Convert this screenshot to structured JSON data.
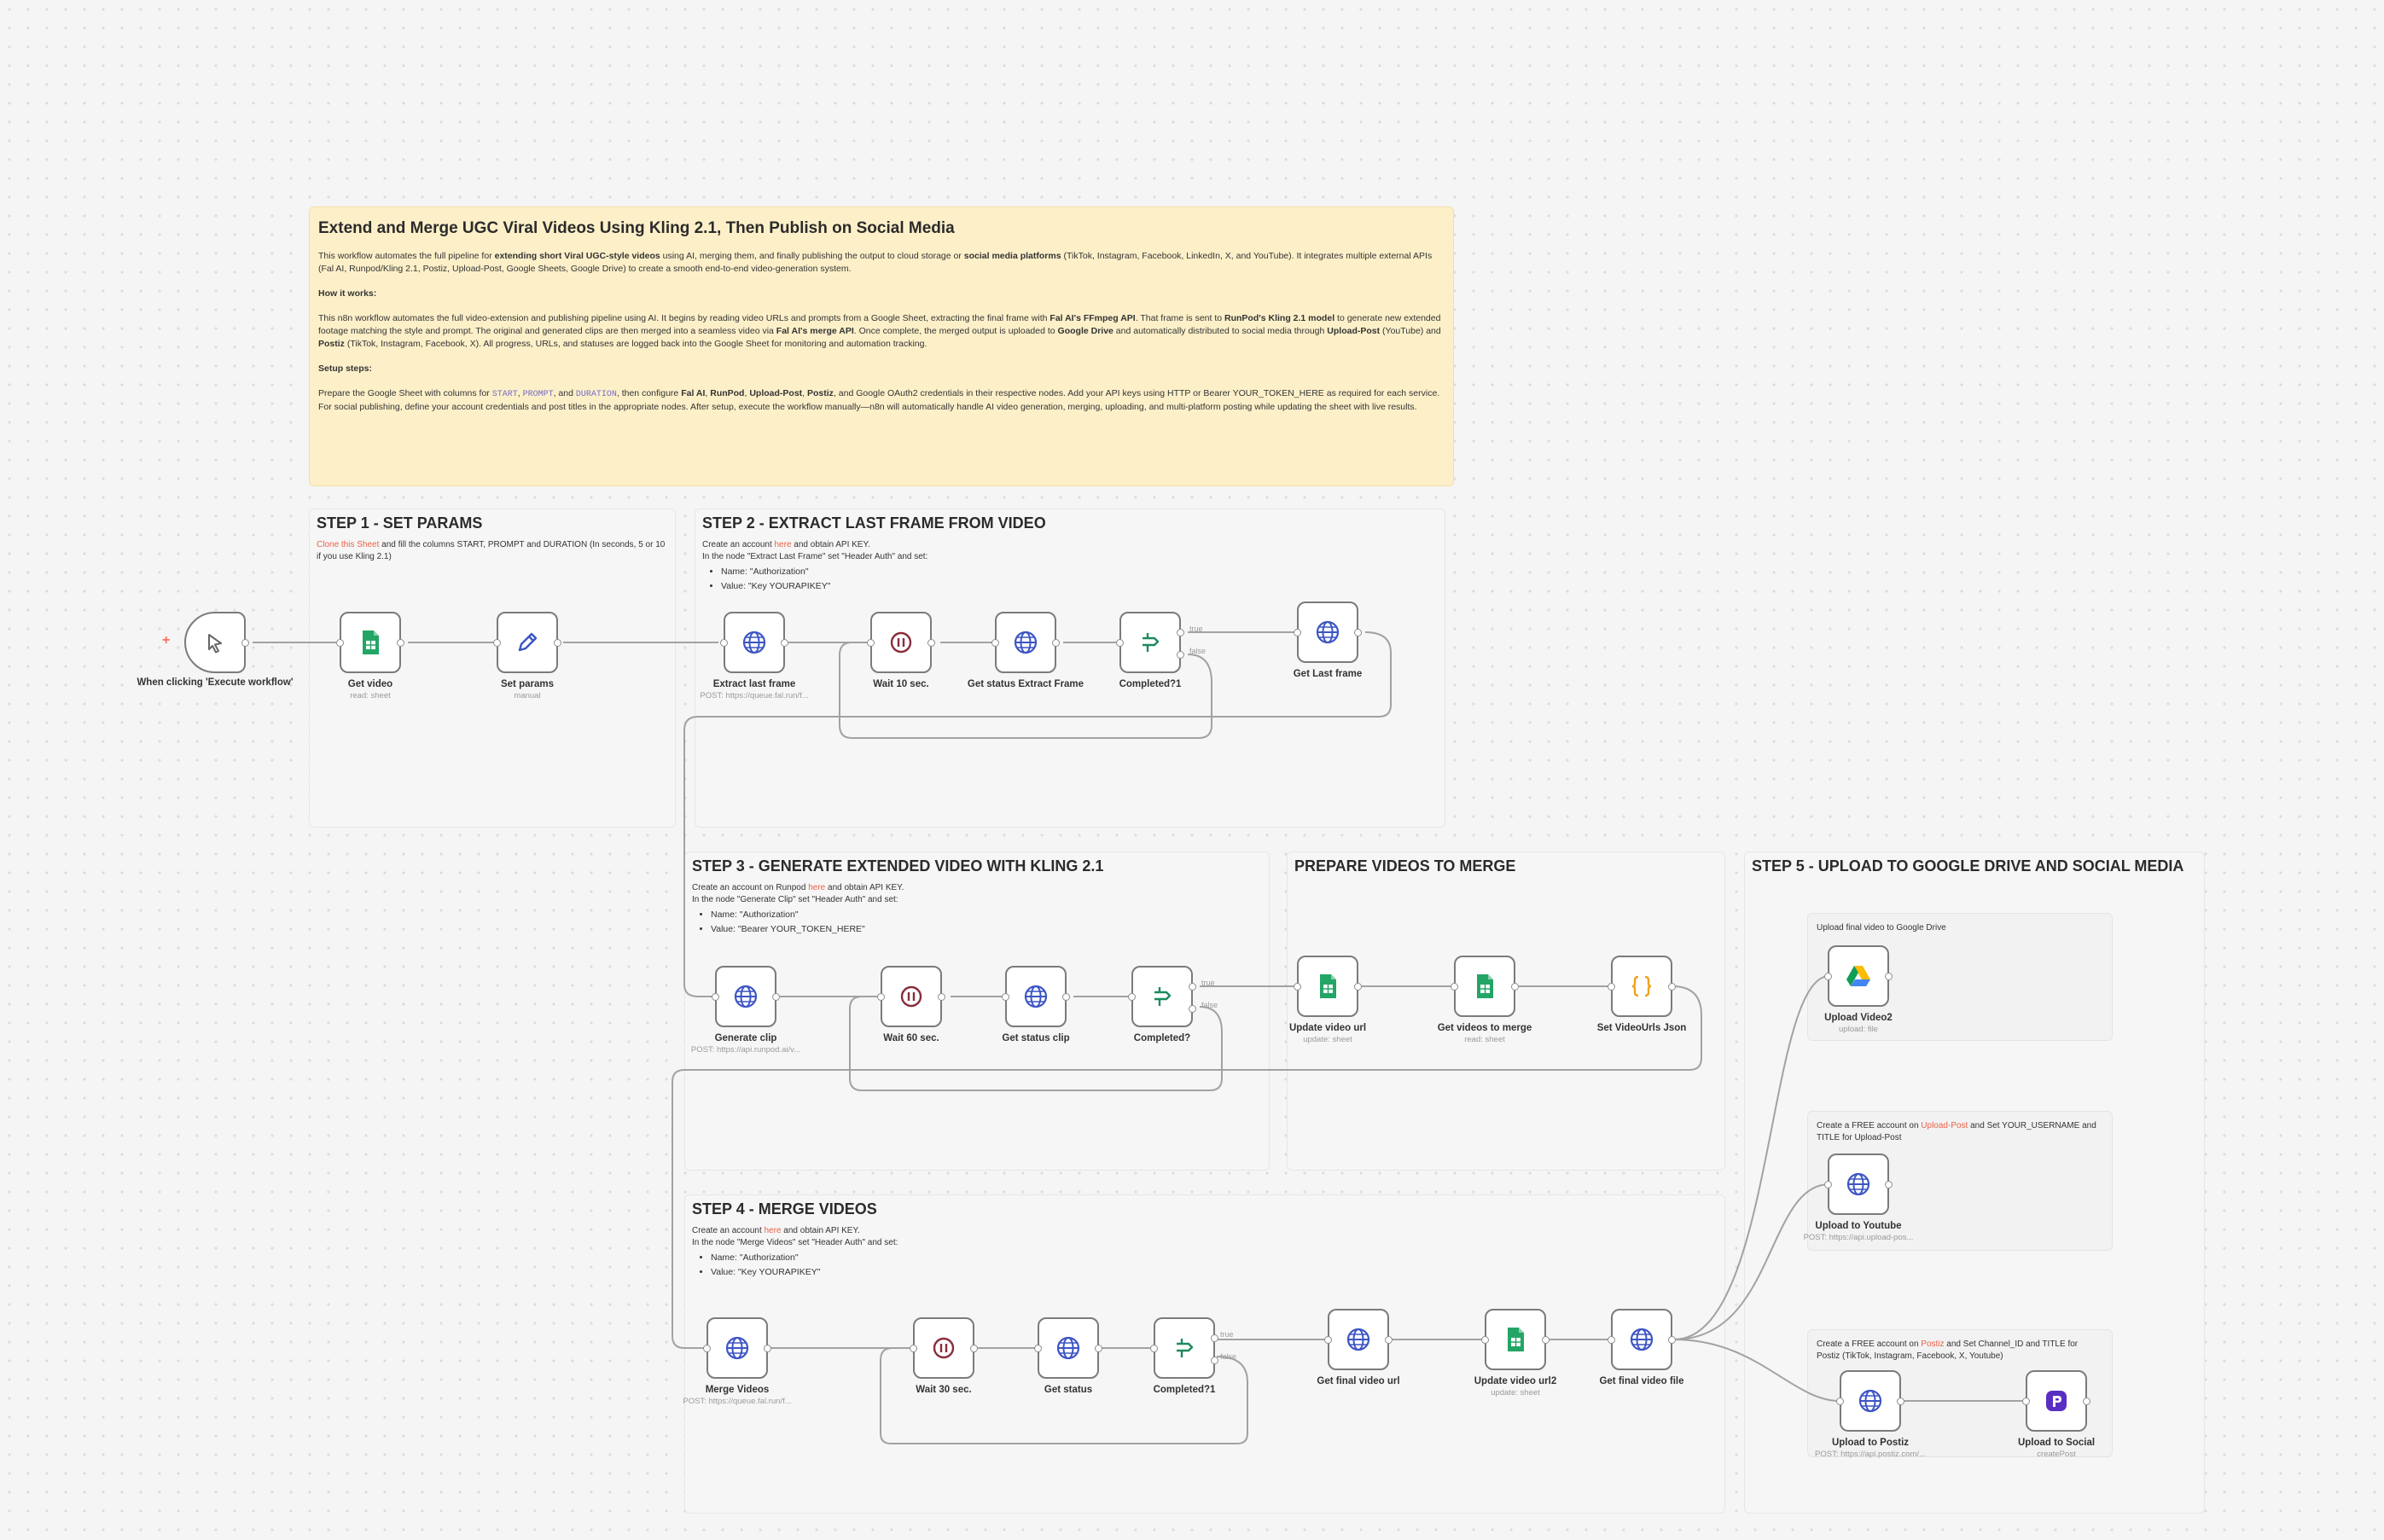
{
  "canvas": {
    "sticky_intro": {
      "title": "Extend and Merge UGC Viral Videos Using Kling 2.1, Then Publish on Social Media",
      "para1_a": "This workflow automates the full pipeline for ",
      "para1_b": "extending short Viral UGC-style videos",
      "para1_c": " using AI, merging them, and finally publishing the output to cloud storage or ",
      "para1_d": "social media platforms",
      "para1_e": " (TikTok, Instagram, Facebook, LinkedIn, X, and YouTube). It integrates multiple external APIs (Fal AI, Runpod/Kling 2.1, Postiz, Upload-Post, Google Sheets, Google Drive) to create a smooth end-to-end video-generation system.",
      "how_heading": "How it works:",
      "para2_a": "This n8n workflow automates the full video-extension and publishing pipeline using AI. It begins by reading video URLs and prompts from a Google Sheet, extracting the final frame with ",
      "para2_b": "Fal AI's FFmpeg API",
      "para2_c": ". That frame is sent to ",
      "para2_d": "RunPod's Kling 2.1 model",
      "para2_e": " to generate new extended footage matching the style and prompt. The original and generated clips are then merged into a seamless video via ",
      "para2_f": "Fal AI's merge API",
      "para2_g": ". Once complete, the merged output is uploaded to ",
      "para2_h": "Google Drive",
      "para2_i": " and automatically distributed to social media through ",
      "para2_j": "Upload-Post",
      "para2_k": " (YouTube) and ",
      "para2_l": "Postiz",
      "para2_m": " (TikTok, Instagram, Facebook, X). All progress, URLs, and statuses are logged back into the Google Sheet for monitoring and automation tracking.",
      "setup_heading": "Setup steps:",
      "para3_a": "Prepare the Google Sheet with columns for ",
      "para3_b": "START",
      "para3_c": ", ",
      "para3_d": "PROMPT",
      "para3_e": ", and ",
      "para3_f": "DURATION",
      "para3_g": ", then configure ",
      "para3_h": "Fal AI",
      "para3_i": ", ",
      "para3_j": "RunPod",
      "para3_k": ", ",
      "para3_l": "Upload-Post",
      "para3_m": ", ",
      "para3_n": "Postiz",
      "para3_o": ", and Google OAuth2 credentials in their respective nodes. Add your API keys using HTTP or Bearer YOUR_TOKEN_HERE as required for each service. For social publishing, define your account credentials and post titles in the appropriate nodes. After setup, execute the workflow manually—n8n will automatically handle AI video generation, merging, uploading, and multi-platform posting while updating the sheet with live results."
    },
    "step1": {
      "title": "STEP 1 - SET PARAMS",
      "link": "Clone this Sheet",
      "text": " and fill the columns START, PROMPT and DURATION (In seconds, 5 or 10 if you use Kling 2.1)"
    },
    "step2": {
      "title": "STEP 2 - EXTRACT LAST FRAME FROM VIDEO",
      "text_a": "Create an account ",
      "link": "here",
      "text_b": " and obtain API KEY.",
      "text_c": "In the node \"Extract Last Frame\" set \"Header Auth\" and set:",
      "bullets": [
        "Name: \"Authorization\"",
        "Value: \"Key YOURAPIKEY\""
      ]
    },
    "step3": {
      "title": "STEP 3 - GENERATE EXTENDED VIDEO WITH KLING 2.1",
      "text_a": "Create an account on Runpod ",
      "link": "here",
      "text_b": " and obtain API KEY.",
      "text_c": "In the node \"Generate Clip\" set \"Header Auth\" and set:",
      "bullets": [
        "Name: \"Authorization\"",
        "Value: \"Bearer YOUR_TOKEN_HERE\""
      ]
    },
    "prepare": {
      "title": "PREPARE VIDEOS TO MERGE"
    },
    "step4": {
      "title": "STEP 4 - MERGE VIDEOS",
      "text_a": "Create an account ",
      "link": "here",
      "text_b": " and obtain API KEY.",
      "text_c": "In the node \"Merge Videos\" set \"Header Auth\" and set:",
      "bullets": [
        "Name: \"Authorization\"",
        "Value: \"Key YOURAPIKEY\""
      ]
    },
    "step5": {
      "title": "STEP 5 - UPLOAD TO GOOGLE DRIVE AND SOCIAL MEDIA",
      "drive_note": "Upload final video to Google Drive",
      "uploadpost_a": "Create a FREE account on ",
      "uploadpost_link": "Upload-Post",
      "uploadpost_b": " and Set YOUR_USERNAME and TITLE for Upload-Post",
      "postiz_a": "Create a FREE account on ",
      "postiz_link": "Postiz",
      "postiz_b": " and Set Channel_ID and TITLE for Postiz (TikTok, Instagram, Facebook, X, Youtube)"
    }
  },
  "nodes": {
    "trigger": {
      "label": "When clicking 'Execute workflow'",
      "icon": "cursor-icon"
    },
    "get_video": {
      "label": "Get video",
      "sub": "read: sheet",
      "icon": "google-sheets-icon"
    },
    "set_params": {
      "label": "Set params",
      "sub": "manual",
      "icon": "pencil-icon"
    },
    "extract_last_frame": {
      "label": "Extract last frame",
      "sub": "POST: https://queue.fal.run/f...",
      "icon": "globe-icon"
    },
    "wait_10": {
      "label": "Wait 10 sec.",
      "icon": "pause-icon"
    },
    "get_status_extract": {
      "label": "Get status Extract Frame",
      "icon": "globe-icon"
    },
    "completed1": {
      "label": "Completed?1",
      "true": "true",
      "false": "false",
      "icon": "if-icon"
    },
    "get_last_frame": {
      "label": "Get Last frame",
      "icon": "globe-icon"
    },
    "generate_clip": {
      "label": "Generate clip",
      "sub": "POST: https://api.runpod.ai/v...",
      "icon": "globe-icon"
    },
    "wait_60": {
      "label": "Wait 60 sec.",
      "icon": "pause-icon"
    },
    "get_status_clip": {
      "label": "Get status clip",
      "icon": "globe-icon"
    },
    "completed": {
      "label": "Completed?",
      "true": "true",
      "false": "false",
      "icon": "if-icon"
    },
    "update_video_url": {
      "label": "Update video url",
      "sub": "update: sheet",
      "icon": "google-sheets-icon"
    },
    "get_videos_merge": {
      "label": "Get videos to merge",
      "sub": "read: sheet",
      "icon": "google-sheets-icon"
    },
    "set_videourls_json": {
      "label": "Set VideoUrls Json",
      "icon": "code-braces-icon"
    },
    "merge_videos": {
      "label": "Merge Videos",
      "sub": "POST: https://queue.fal.run/f...",
      "icon": "globe-icon"
    },
    "wait_30": {
      "label": "Wait 30 sec.",
      "icon": "pause-icon"
    },
    "get_status": {
      "label": "Get status",
      "icon": "globe-icon"
    },
    "completed2": {
      "label": "Completed?1",
      "true": "true",
      "false": "false",
      "icon": "if-icon"
    },
    "get_final_video_url": {
      "label": "Get final video url",
      "icon": "globe-icon"
    },
    "update_video_url2": {
      "label": "Update video url2",
      "sub": "update: sheet",
      "icon": "google-sheets-icon"
    },
    "get_final_video_file": {
      "label": "Get final video file",
      "icon": "globe-icon"
    },
    "upload_video2": {
      "label": "Upload Video2",
      "sub": "upload: file",
      "icon": "google-drive-icon"
    },
    "upload_youtube": {
      "label": "Upload to Youtube",
      "sub": "POST: https://api.upload-pos...",
      "icon": "globe-icon"
    },
    "upload_postiz": {
      "label": "Upload to Postiz",
      "sub": "POST: https://api.postiz.com/...",
      "icon": "globe-icon"
    },
    "upload_social": {
      "label": "Upload to Social",
      "sub": "createPost",
      "icon": "postiz-icon"
    }
  },
  "colors": {
    "accent_link": "#e8624a",
    "sheets_green": "#23a566",
    "globe_blue": "#3c55c4",
    "wait_maroon": "#8a2c3a",
    "if_green": "#1e8a5e",
    "code_orange": "#f0a21c",
    "postiz_purple": "#5a2ec2"
  }
}
